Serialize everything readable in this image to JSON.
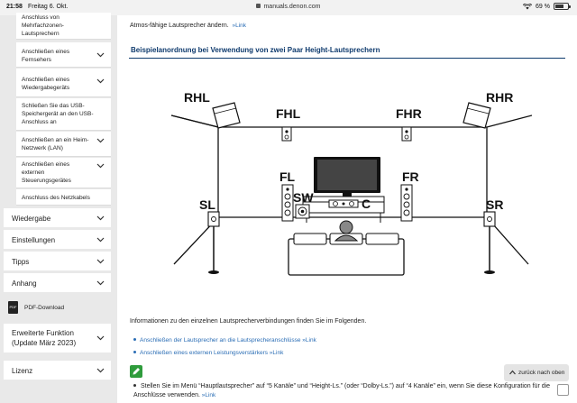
{
  "status_bar": {
    "time": "21:58",
    "date": "Freitag 6. Okt.",
    "url": "manuals.denon.com",
    "battery": "69 %"
  },
  "sidebar": {
    "top_partial": "Anschluss von Mehrfachzonen-Lautsprechern",
    "sub_items": [
      {
        "label": "Anschließen eines Fernsehers"
      },
      {
        "label": "Anschließen eines Wiedergabegeräts"
      },
      {
        "label": "Schließen Sie das USB-Speichergerät an den USB-Anschluss an"
      },
      {
        "label": "Anschließen an ein Heim-Netzwerk (LAN)"
      },
      {
        "label": "Anschließen eines externen Steuerungsgerätes"
      },
      {
        "label": "Anschluss des Netzkabels"
      }
    ],
    "main_items": [
      {
        "label": "Wiedergabe"
      },
      {
        "label": "Einstellungen"
      },
      {
        "label": "Tipps"
      },
      {
        "label": "Anhang"
      }
    ],
    "pdf_label": "PDF-Download",
    "pdf_icon_text": "PDF",
    "extended_label": "Erweiterte Funktion (Update März 2023)",
    "license_label": "Lizenz"
  },
  "main": {
    "intro_text": "Atmos-fähige Lautsprecher ändern.",
    "link_label": "Link",
    "section_title": "Beispielanordnung bei Verwendung von zwei Paar Height-Lautsprechern",
    "diagram_labels": {
      "rhl": "RHL",
      "rhr": "RHR",
      "fhl": "FHL",
      "fhr": "FHR",
      "fl": "FL",
      "fr": "FR",
      "sl": "SL",
      "sr": "SR",
      "sw": "SW",
      "c": "C"
    },
    "info_text": "Informationen zu den einzelnen Lautsprecherverbindungen finden Sie im Folgenden.",
    "links": [
      {
        "label": "Anschließen der Lautsprecher an die Lautsprecheranschlüsse",
        "suffix": "Link"
      },
      {
        "label": "Anschließen eines externen Leistungsverstärkers",
        "suffix": "Link"
      }
    ],
    "step_text": "Stellen Sie im Menü “Hauptlautsprecher” auf “5 Kanäle” und “Height-Ls.” (oder “Dolby-Ls.”) auf “4 Kanäle” ein, wenn Sie diese Konfiguration für die Anschlüsse verwenden.",
    "step_link": "Link",
    "back_to_top": "zurück nach oben"
  },
  "colors": {
    "title_blue": "#0e3a6d",
    "link_blue": "#2a6db5",
    "sidebar_bg": "#e9e9e9",
    "pencil_green": "#2f9c3c"
  }
}
